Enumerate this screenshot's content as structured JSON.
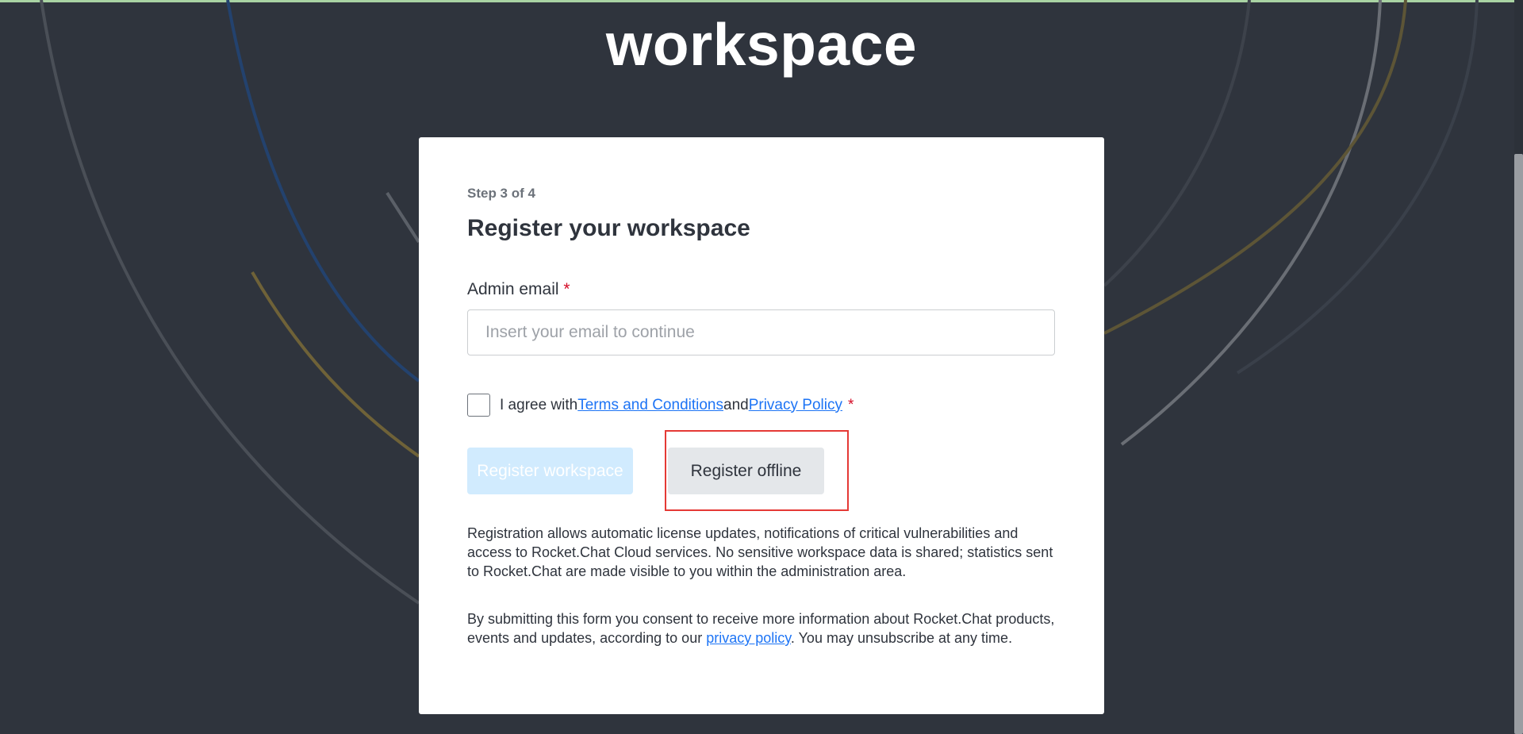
{
  "hero": {
    "title": "workspace"
  },
  "form": {
    "step_label": "Step 3 of 4",
    "title": "Register your workspace",
    "email": {
      "label": "Admin email",
      "required_mark": "*",
      "placeholder": "Insert your email to continue",
      "value": ""
    },
    "agree": {
      "checked": false,
      "prefix": "I agree with",
      "terms_link": "Terms and Conditions",
      "joiner": "and",
      "privacy_link": "Privacy Policy",
      "required_mark": "*"
    },
    "buttons": {
      "register_workspace": "Register workspace",
      "register_offline": "Register offline"
    },
    "registration_info": "Registration allows automatic license updates, notifications of critical vulnerabilities and access to Rocket.Chat Cloud services. No sensitive workspace data is shared; statistics sent to Rocket.Chat are made visible to you within the administration area.",
    "consent": {
      "before": "By submitting this form you consent to receive more information about Rocket.Chat products, events and updates, according to our ",
      "link": "privacy policy",
      "after": ". You may unsubscribe at any time."
    }
  },
  "colors": {
    "background": "#2f343d",
    "primary_disabled": "#d1ebfe",
    "secondary": "#e4e7ea",
    "link": "#1d74f5",
    "danger": "#d40c26",
    "highlight": "#e53935"
  }
}
